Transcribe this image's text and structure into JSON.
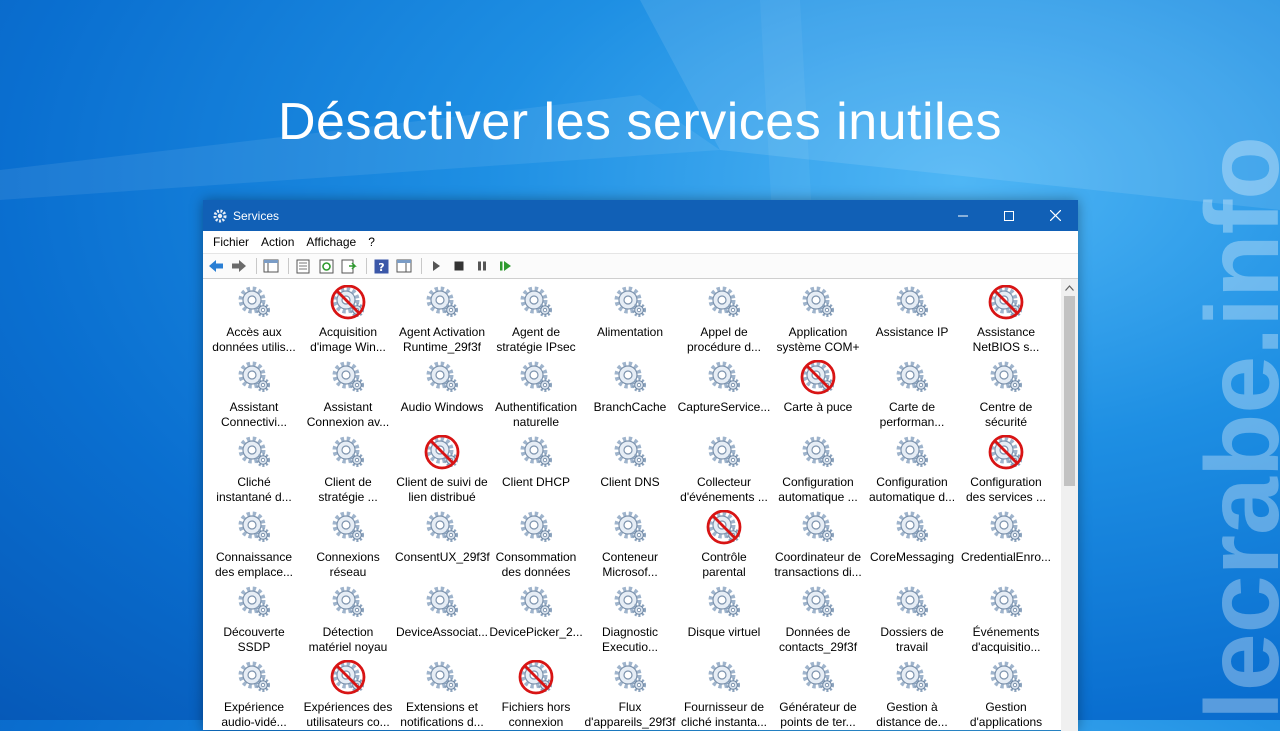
{
  "headline": "Désactiver les services inutiles",
  "watermark": "lecrabe.info",
  "window": {
    "title": "Services"
  },
  "menu": [
    "Fichier",
    "Action",
    "Affichage",
    "?"
  ],
  "services": [
    {
      "label": "Accès aux\ndonnées utilis...",
      "disabled": false
    },
    {
      "label": "Acquisition\nd'image Win...",
      "disabled": true
    },
    {
      "label": "Agent Activation\nRuntime_29f3f",
      "disabled": false
    },
    {
      "label": "Agent de\nstratégie IPsec",
      "disabled": false
    },
    {
      "label": "Alimentation",
      "disabled": false
    },
    {
      "label": "Appel de\nprocédure d...",
      "disabled": false
    },
    {
      "label": "Application\nsystème COM+",
      "disabled": false
    },
    {
      "label": "Assistance IP",
      "disabled": false
    },
    {
      "label": "Assistance\nNetBIOS s...",
      "disabled": true
    },
    {
      "label": "Assistant\nConnectivi...",
      "disabled": false
    },
    {
      "label": "Assistant\nConnexion av...",
      "disabled": false
    },
    {
      "label": "Audio Windows",
      "disabled": false
    },
    {
      "label": "Authentification\nnaturelle",
      "disabled": false
    },
    {
      "label": "BranchCache",
      "disabled": false
    },
    {
      "label": "CaptureService...",
      "disabled": false
    },
    {
      "label": "Carte à puce",
      "disabled": true
    },
    {
      "label": "Carte de\nperforman...",
      "disabled": false
    },
    {
      "label": "Centre de\nsécurité",
      "disabled": false
    },
    {
      "label": "Cliché\ninstantané d...",
      "disabled": false
    },
    {
      "label": "Client de\nstratégie ...",
      "disabled": false
    },
    {
      "label": "Client de suivi de\nlien distribué",
      "disabled": true
    },
    {
      "label": "Client DHCP",
      "disabled": false
    },
    {
      "label": "Client DNS",
      "disabled": false
    },
    {
      "label": "Collecteur\nd'événements ...",
      "disabled": false
    },
    {
      "label": "Configuration\nautomatique ...",
      "disabled": false
    },
    {
      "label": "Configuration\nautomatique d...",
      "disabled": false
    },
    {
      "label": "Configuration\ndes services ...",
      "disabled": true
    },
    {
      "label": "Connaissance\ndes emplace...",
      "disabled": false
    },
    {
      "label": "Connexions\nréseau",
      "disabled": false
    },
    {
      "label": "ConsentUX_29f3f",
      "disabled": false
    },
    {
      "label": "Consommation\ndes données",
      "disabled": false
    },
    {
      "label": "Conteneur\nMicrosof...",
      "disabled": false
    },
    {
      "label": "Contrôle\nparental",
      "disabled": true
    },
    {
      "label": "Coordinateur de\ntransactions di...",
      "disabled": false
    },
    {
      "label": "CoreMessaging",
      "disabled": false
    },
    {
      "label": "CredentialEnro...",
      "disabled": false
    },
    {
      "label": "Découverte SSDP",
      "disabled": false
    },
    {
      "label": "Détection\nmatériel noyau",
      "disabled": false
    },
    {
      "label": "DeviceAssociat...",
      "disabled": false
    },
    {
      "label": "DevicePicker_2...",
      "disabled": false
    },
    {
      "label": "Diagnostic\nExecutio...",
      "disabled": false
    },
    {
      "label": "Disque virtuel",
      "disabled": false
    },
    {
      "label": "Données de\ncontacts_29f3f",
      "disabled": false
    },
    {
      "label": "Dossiers de\ntravail",
      "disabled": false
    },
    {
      "label": "Événements\nd'acquisitio...",
      "disabled": false
    },
    {
      "label": "Expérience\naudio-vidé...",
      "disabled": false
    },
    {
      "label": "Expériences des\nutilisateurs co...",
      "disabled": true
    },
    {
      "label": "Extensions et\nnotifications d...",
      "disabled": false
    },
    {
      "label": "Fichiers hors\nconnexion",
      "disabled": true
    },
    {
      "label": "Flux\nd'appareils_29f3f",
      "disabled": false
    },
    {
      "label": "Fournisseur de\ncliché instanta...",
      "disabled": false
    },
    {
      "label": "Générateur de\npoints de ter...",
      "disabled": false
    },
    {
      "label": "Gestion à\ndistance de...",
      "disabled": false
    },
    {
      "label": "Gestion\nd'applications",
      "disabled": false
    }
  ]
}
